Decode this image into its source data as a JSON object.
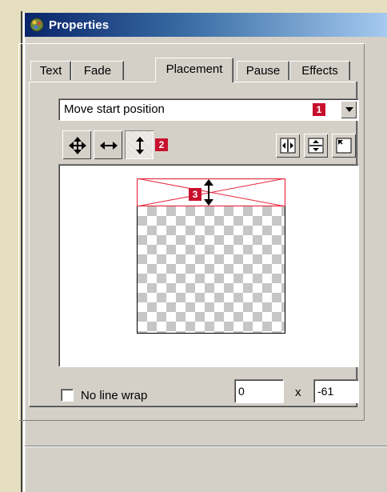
{
  "window": {
    "title": "Properties"
  },
  "tabs": [
    {
      "label": "Text"
    },
    {
      "label": "Fade"
    },
    {
      "label": "Placement"
    },
    {
      "label": "Pause"
    },
    {
      "label": "Effects"
    }
  ],
  "active_tab": "Placement",
  "dropdown": {
    "selected": "Move start position"
  },
  "badges": [
    "1",
    "2",
    "3"
  ],
  "toolbar": {
    "left_icons": [
      "move-both-icon",
      "move-horizontal-icon",
      "move-vertical-icon"
    ],
    "right_icons": [
      "center-horizontal-icon",
      "center-vertical-icon",
      "align-top-left-icon"
    ]
  },
  "options": {
    "no_line_wrap_label": "No line wrap",
    "no_line_wrap_checked": false
  },
  "position": {
    "x_value": "0",
    "separator": "x",
    "y_value": "-61"
  },
  "colors": {
    "title_bar_start": "#0a246a",
    "title_bar_end": "#a6caf0",
    "badge": "#c8102e",
    "window_face": "#d4d0c8",
    "page_background": "#e6dfbf",
    "start_box_outline": "#e8243c"
  }
}
